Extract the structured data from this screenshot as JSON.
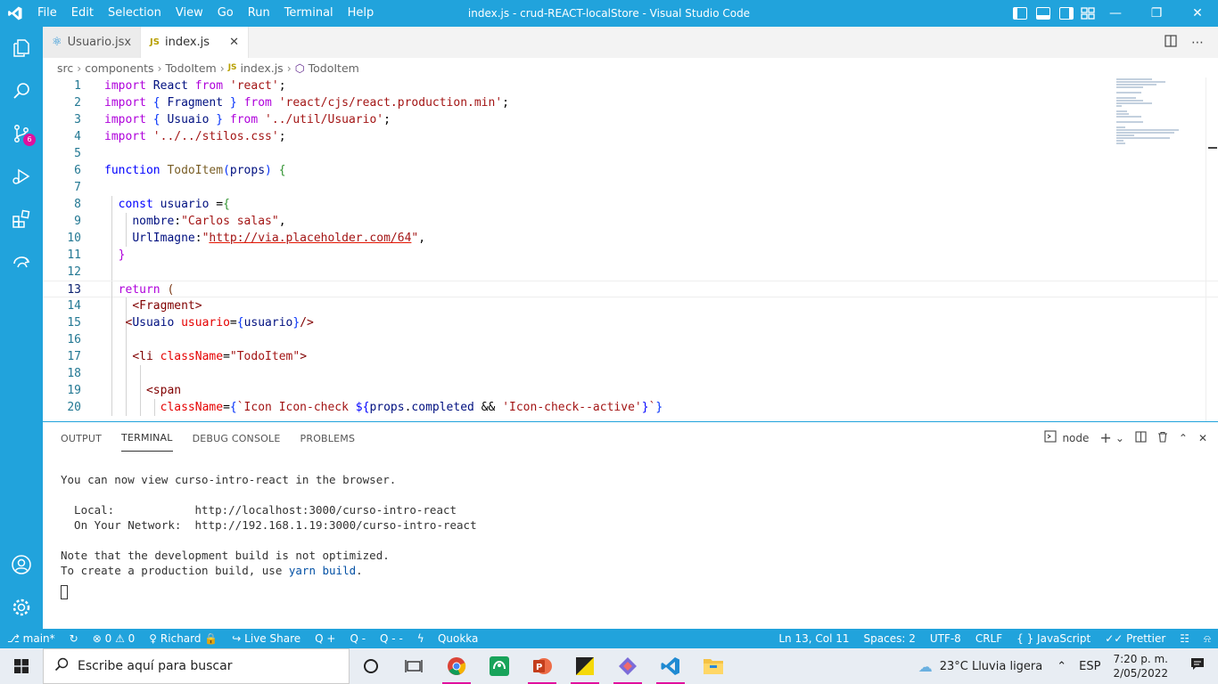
{
  "window": {
    "title": "index.js - crud-REACT-localStore - Visual Studio Code",
    "menu": [
      "File",
      "Edit",
      "Selection",
      "View",
      "Go",
      "Run",
      "Terminal",
      "Help"
    ]
  },
  "activity": {
    "scm_badge": "6"
  },
  "tabs": [
    {
      "label": "Usuario.jsx",
      "icon": "react-icon",
      "active": false
    },
    {
      "label": "index.js",
      "icon_text": "JS",
      "active": true
    }
  ],
  "breadcrumb": {
    "parts": [
      "src",
      "components",
      "TodoItem",
      "index.js",
      "TodoItem"
    ],
    "js_label": "JS"
  },
  "editor": {
    "line_numbers": [
      "1",
      "2",
      "3",
      "4",
      "5",
      "6",
      "7",
      "8",
      "9",
      "10",
      "11",
      "12",
      "13",
      "14",
      "15",
      "16",
      "17",
      "18",
      "19",
      "20"
    ]
  },
  "panel": {
    "tabs": [
      "OUTPUT",
      "TERMINAL",
      "DEBUG CONSOLE",
      "PROBLEMS"
    ],
    "active_tab": "TERMINAL",
    "shell": "node",
    "terminal_lines": {
      "l1_prefix": "You can now view ",
      "l1_app": "curso-intro-react",
      "l1_suffix": " in the browser.",
      "local_label": "  Local:            ",
      "local_url": "http://localhost:3000/curso-intro-react",
      "network_label": "  On Your Network:  ",
      "network_url": "http://192.168.1.19:3000/curso-intro-react",
      "note": "Note that the development build is not optimized.",
      "prod_prefix": "To create a production build, use ",
      "prod_cmd": "yarn build",
      "prod_suffix": "."
    }
  },
  "status": {
    "branch": "main*",
    "errors": "0",
    "warnings": "0",
    "user": "Richard",
    "live_share": "Live Share",
    "q1": "Q +",
    "q2": "Q -",
    "q3": "Q - -",
    "quokka": "Quokka",
    "position": "Ln 13, Col 11",
    "spaces": "Spaces: 2",
    "encoding": "UTF-8",
    "eol": "CRLF",
    "language": "JavaScript",
    "prettier": "Prettier"
  },
  "taskbar": {
    "search_placeholder": "Escribe aquí para buscar",
    "weather": "23°C  Lluvia ligera",
    "lang": "ESP",
    "time": "7:20 p. m.",
    "date": "2/05/2022"
  },
  "colors": {
    "accent": "#21a3dc",
    "badge": "#e0109e"
  }
}
